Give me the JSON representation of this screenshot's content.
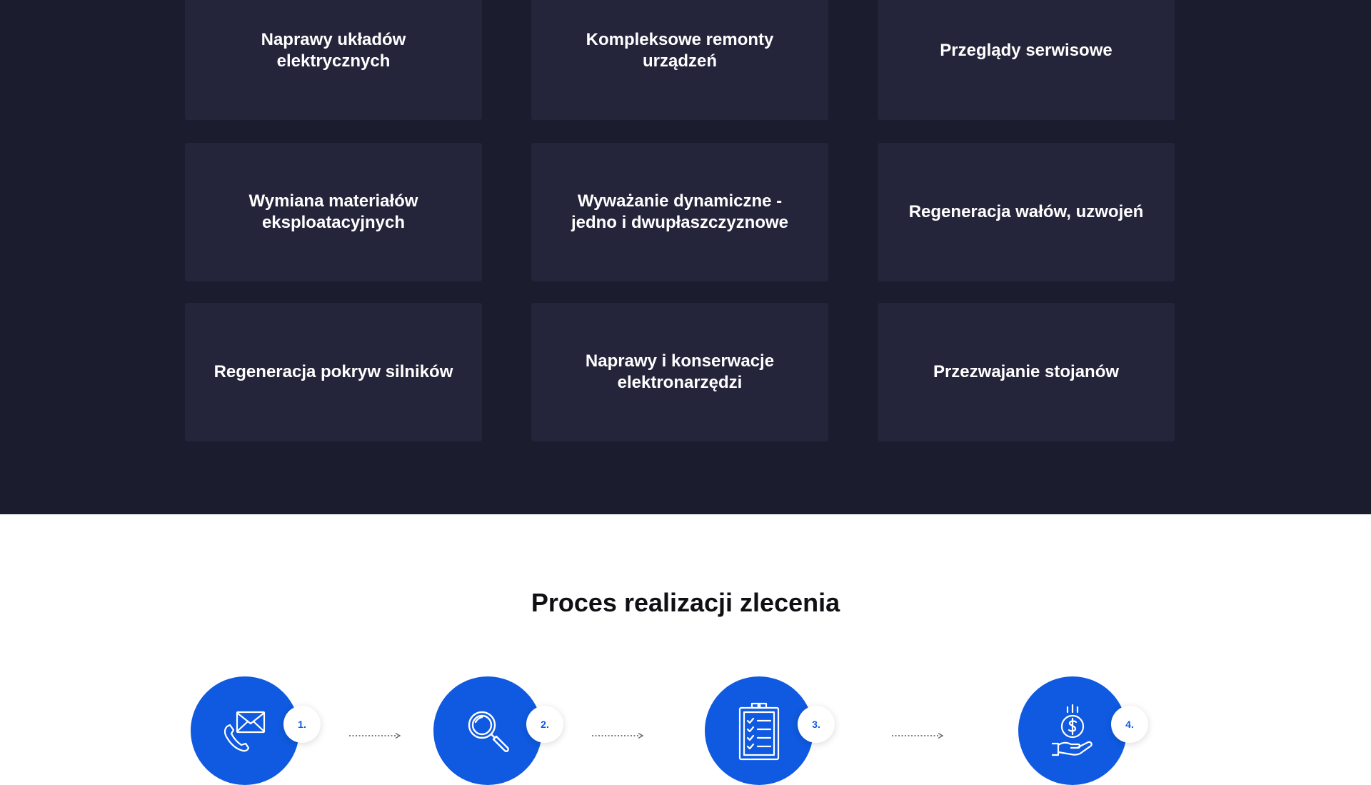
{
  "services": {
    "cards": [
      {
        "label": "Naprawy układów elektrycznych"
      },
      {
        "label": "Kompleksowe remonty urządzeń"
      },
      {
        "label": "Przeglądy serwisowe"
      },
      {
        "label": "Wymiana materiałów eksploatacyjnych"
      },
      {
        "label": "Wyważanie dynamiczne - jedno i dwupłaszczyznowe"
      },
      {
        "label": "Regeneracja wałów, uzwojeń"
      },
      {
        "label": "Regeneracja pokryw silników"
      },
      {
        "label": "Naprawy i konserwacje elektronarzędzi"
      },
      {
        "label": "Przezwajanie stojanów"
      }
    ]
  },
  "process": {
    "title": "Proces realizacji zlecenia",
    "steps": [
      {
        "number": "1.",
        "icon": "phone-mail-icon"
      },
      {
        "number": "2.",
        "icon": "magnifier-icon"
      },
      {
        "number": "3.",
        "icon": "clipboard-checklist-icon"
      },
      {
        "number": "4.",
        "icon": "money-hand-icon"
      }
    ]
  },
  "colors": {
    "services_bg": "#1b1c2e",
    "card_bg": "#24253a",
    "accent": "#0f5ae0",
    "title": "#0f0f14"
  }
}
